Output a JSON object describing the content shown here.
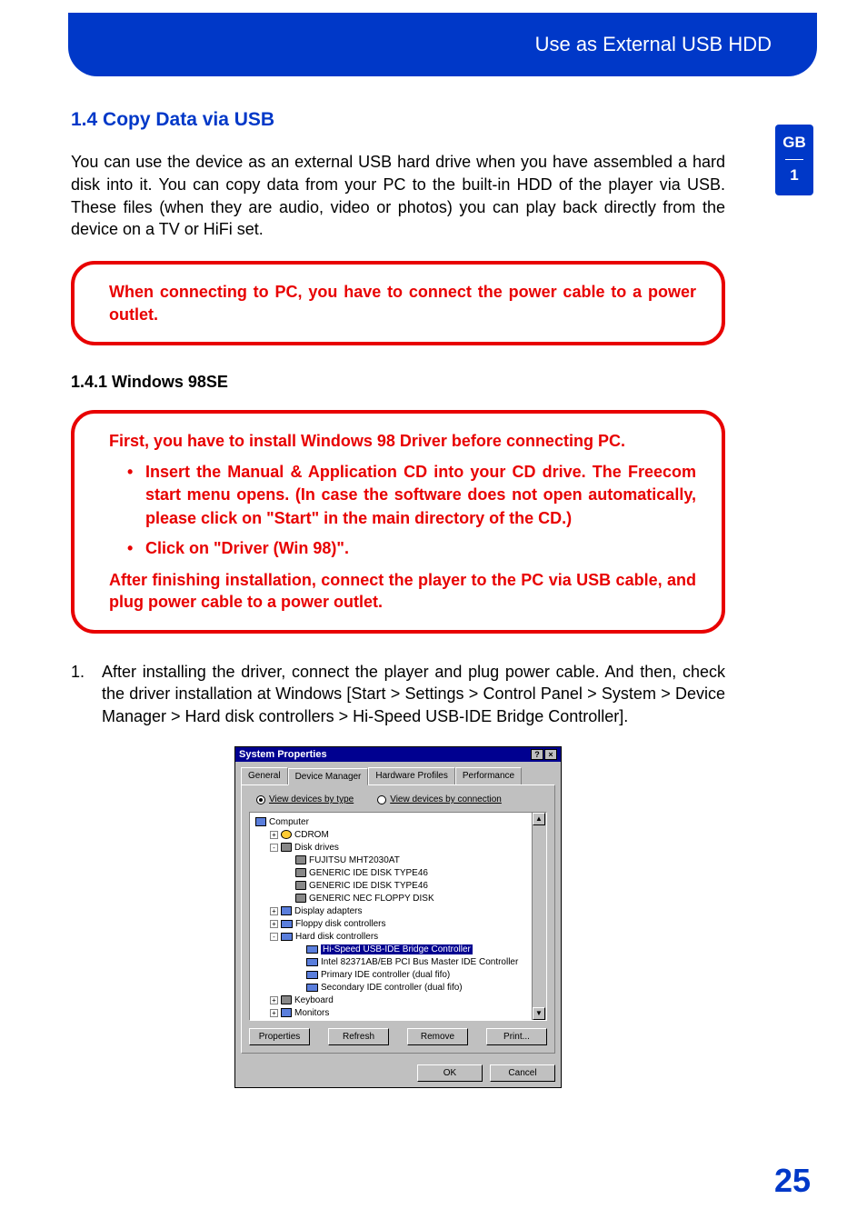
{
  "header": {
    "title": "Use as External USB HDD"
  },
  "sideTab": {
    "lang": "GB",
    "chapter": "1"
  },
  "section": {
    "title": "1.4 Copy Data via USB"
  },
  "intro": "You can use the device as an external USB hard drive when you have assembled a hard disk into it. You can copy data from your PC to the built-in HDD of the player via USB. These files (when they are audio, video or photos) you can play back directly from the device on a TV or HiFi set.",
  "callout1": "When connecting to PC, you have to connect the power cable to a power outlet.",
  "subsection": {
    "title": "1.4.1 Windows 98SE"
  },
  "callout2": {
    "intro": "First, you have to install Windows 98 Driver before connecting PC.",
    "items": [
      "Insert the Manual & Application CD into your CD drive. The Freecom start menu opens. (In case the software does not open automatically, please click on \"Start\" in the main directory of the CD.)",
      "Click on \"Driver (Win 98)\"."
    ],
    "outro": "After finishing installation, connect the player to the PC via USB cable, and plug power cable to a power outlet."
  },
  "step": {
    "num": "1.",
    "text": "After installing the driver, connect the player and plug power cable. And then, check the driver installation at Windows [Start > Settings > Control Panel > System > Device Manager > Hard disk controllers > Hi-Speed USB-IDE Bridge Controller]."
  },
  "dialog": {
    "title": "System Properties",
    "help": "?",
    "close": "×",
    "tabs": [
      "General",
      "Device Manager",
      "Hardware Profiles",
      "Performance"
    ],
    "radios": {
      "byType": "View devices by type",
      "byConn": "View devices by connection"
    },
    "tree": {
      "root": "Computer",
      "cdrom": "CDROM",
      "diskDrives": "Disk drives",
      "d1": "FUJITSU MHT2030AT",
      "d2": "GENERIC IDE  DISK TYPE46",
      "d3": "GENERIC IDE  DISK TYPE46",
      "d4": "GENERIC NEC  FLOPPY DISK",
      "display": "Display adapters",
      "floppy": "Floppy disk controllers",
      "hdc": "Hard disk controllers",
      "hdc1": "Hi-Speed USB-IDE Bridge Controller",
      "hdc2": "Intel 82371AB/EB PCI Bus Master IDE Controller",
      "hdc3": "Primary IDE controller (dual fifo)",
      "hdc4": "Secondary IDE controller (dual fifo)",
      "keyboard": "Keyboard",
      "monitors": "Monitors"
    },
    "buttons": {
      "properties": "Properties",
      "refresh": "Refresh",
      "remove": "Remove",
      "print": "Print..."
    },
    "footer": {
      "ok": "OK",
      "cancel": "Cancel"
    }
  },
  "pageNumber": "25"
}
